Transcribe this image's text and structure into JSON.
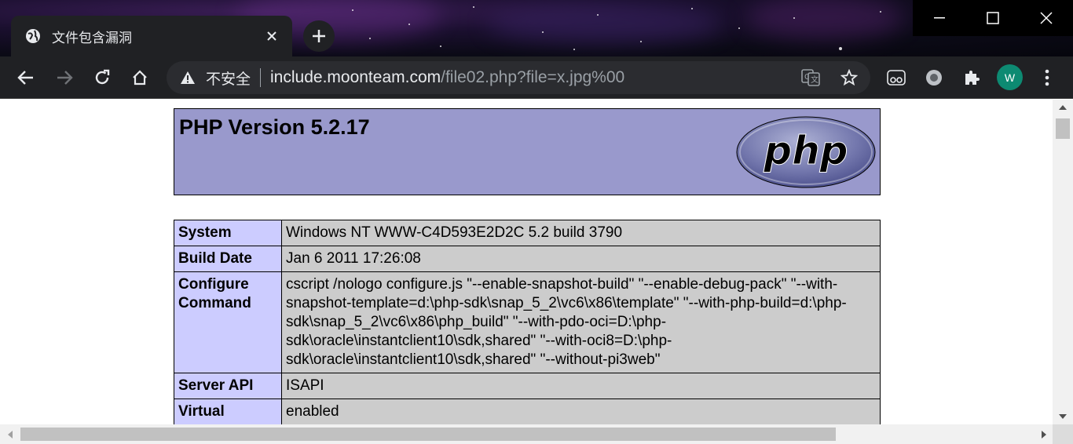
{
  "browser": {
    "tab": {
      "title": "文件包含漏洞",
      "favicon": "globe-icon"
    },
    "window_controls": [
      "minimize-icon",
      "maximize-icon",
      "close-icon"
    ],
    "nav_icons": [
      "back-arrow-icon",
      "forward-arrow-icon",
      "reload-icon",
      "home-icon"
    ],
    "omnibox": {
      "security_label": "不安全",
      "url_host": "include.moonteam.com",
      "url_path": "/file02.php?file=x.jpg%00"
    },
    "toolbar_icons": [
      "translate-icon",
      "bookmark-star-icon",
      "reading-mode-icon",
      "extension-circle-icon",
      "extensions-puzzle-icon",
      "menu-dots-icon"
    ],
    "profile_initial": "W",
    "colors": {
      "chrome_bg": "#202124",
      "omnibox_bg": "#2b2c30",
      "avatar_bg": "#0d8a72"
    }
  },
  "page": {
    "header_title": "PHP Version 5.2.17",
    "logo_text": "php",
    "colors": {
      "header_bg": "#9999cc",
      "label_bg": "#ccccff",
      "value_bg": "#cccccc"
    },
    "rows": [
      {
        "label": "System",
        "value": "Windows NT WWW-C4D593E2D2C 5.2 build 3790"
      },
      {
        "label": "Build Date",
        "value": "Jan 6 2011 17:26:08"
      },
      {
        "label": "Configure Command",
        "value": "cscript /nologo configure.js \"--enable-snapshot-build\" \"--enable-debug-pack\" \"--with-snapshot-template=d:\\php-sdk\\snap_5_2\\vc6\\x86\\template\" \"--with-php-build=d:\\php-sdk\\snap_5_2\\vc6\\x86\\php_build\" \"--with-pdo-oci=D:\\php-sdk\\oracle\\instantclient10\\sdk,shared\" \"--with-oci8=D:\\php-sdk\\oracle\\instantclient10\\sdk,shared\" \"--without-pi3web\""
      },
      {
        "label": "Server API",
        "value": "ISAPI"
      },
      {
        "label": "Virtual",
        "value": "enabled"
      }
    ]
  }
}
